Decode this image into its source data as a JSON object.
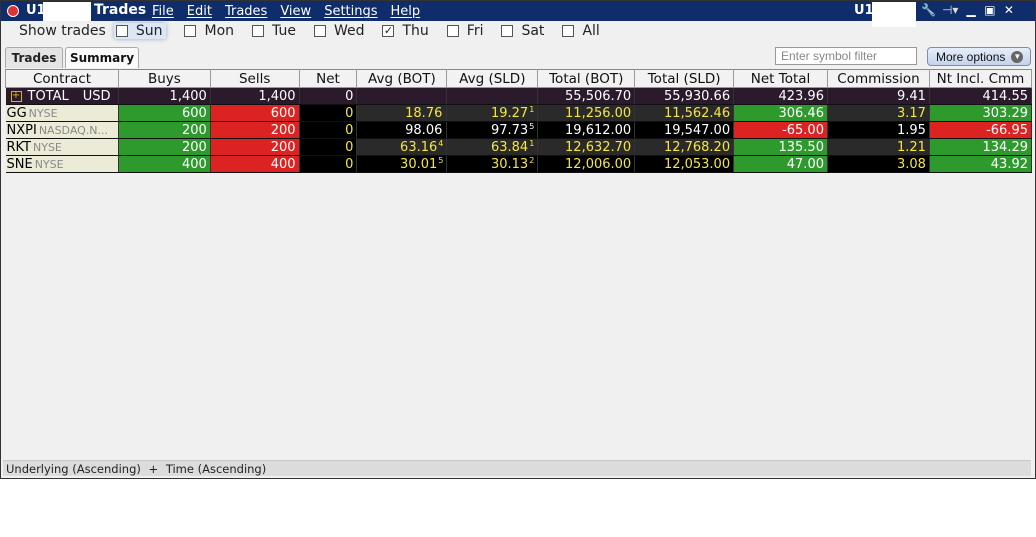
{
  "titlebar": {
    "account": "U1",
    "title": "Trades",
    "menu": [
      "File",
      "Edit",
      "Trades",
      "View",
      "Settings",
      "Help"
    ],
    "account_right": "U1"
  },
  "show_trades": {
    "label": "Show trades",
    "days": [
      {
        "name": "Sun",
        "checked": false
      },
      {
        "name": "Mon",
        "checked": false
      },
      {
        "name": "Tue",
        "checked": false
      },
      {
        "name": "Wed",
        "checked": false
      },
      {
        "name": "Thu",
        "checked": true
      },
      {
        "name": "Fri",
        "checked": false
      },
      {
        "name": "Sat",
        "checked": false
      },
      {
        "name": "All",
        "checked": false
      }
    ]
  },
  "tabs": [
    "Trades",
    "Summary"
  ],
  "filter": {
    "placeholder": "Enter symbol filter"
  },
  "more_options": "More options",
  "columns": [
    "Contract",
    "Buys",
    "Sells",
    "Net",
    "Avg (BOT)",
    "Avg (SLD)",
    "Total (BOT)",
    "Total (SLD)",
    "Net Total",
    "Commission",
    "Nt Incl. Cmm"
  ],
  "total_row": {
    "label": "TOTAL",
    "currency": "USD",
    "buys": "1,400",
    "sells": "1,400",
    "net": "0",
    "avg_bot": "",
    "avg_sld": "",
    "total_bot": "55,506.70",
    "total_sld": "55,930.66",
    "net_total": "423.96",
    "commission": "9.41",
    "nt_incl": "414.55"
  },
  "rows": [
    {
      "symbol": "GG",
      "exchange": "NYSE",
      "buys": "600",
      "sells": "600",
      "net": "0",
      "avg_bot": "18.76",
      "avg_bot_sup": "",
      "avg_sld": "19.27",
      "avg_sld_sup": "1",
      "total_bot": "11,256.00",
      "total_sld": "11,562.46",
      "net_total": "306.46",
      "commission": "3.17",
      "nt_incl": "303.29"
    },
    {
      "symbol": "NXPI",
      "exchange": "NASDAQ.N...",
      "buys": "200",
      "sells": "200",
      "net": "0",
      "avg_bot": "98.06",
      "avg_bot_sup": "",
      "avg_sld": "97.73",
      "avg_sld_sup": "5",
      "total_bot": "19,612.00",
      "total_sld": "19,547.00",
      "net_total": "-65.00",
      "commission": "1.95",
      "nt_incl": "-66.95"
    },
    {
      "symbol": "RKT",
      "exchange": "NYSE",
      "buys": "200",
      "sells": "200",
      "net": "0",
      "avg_bot": "63.16",
      "avg_bot_sup": "4",
      "avg_sld": "63.84",
      "avg_sld_sup": "1",
      "total_bot": "12,632.70",
      "total_sld": "12,768.20",
      "net_total": "135.50",
      "commission": "1.21",
      "nt_incl": "134.29"
    },
    {
      "symbol": "SNE",
      "exchange": "NYSE",
      "buys": "400",
      "sells": "400",
      "net": "0",
      "avg_bot": "30.01",
      "avg_bot_sup": "5",
      "avg_sld": "30.13",
      "avg_sld_sup": "2",
      "total_bot": "12,006.00",
      "total_sld": "12,053.00",
      "net_total": "47.00",
      "commission": "3.08",
      "nt_incl": "43.92"
    }
  ],
  "status": {
    "sort_primary": "Underlying (Ascending)",
    "plus": "+",
    "sort_secondary": "Time (Ascending)"
  },
  "colors": {
    "titlebar": "#0f2c6b",
    "gain": "#2e9a2e",
    "loss": "#d22222",
    "avg_text": "#f5e642"
  }
}
